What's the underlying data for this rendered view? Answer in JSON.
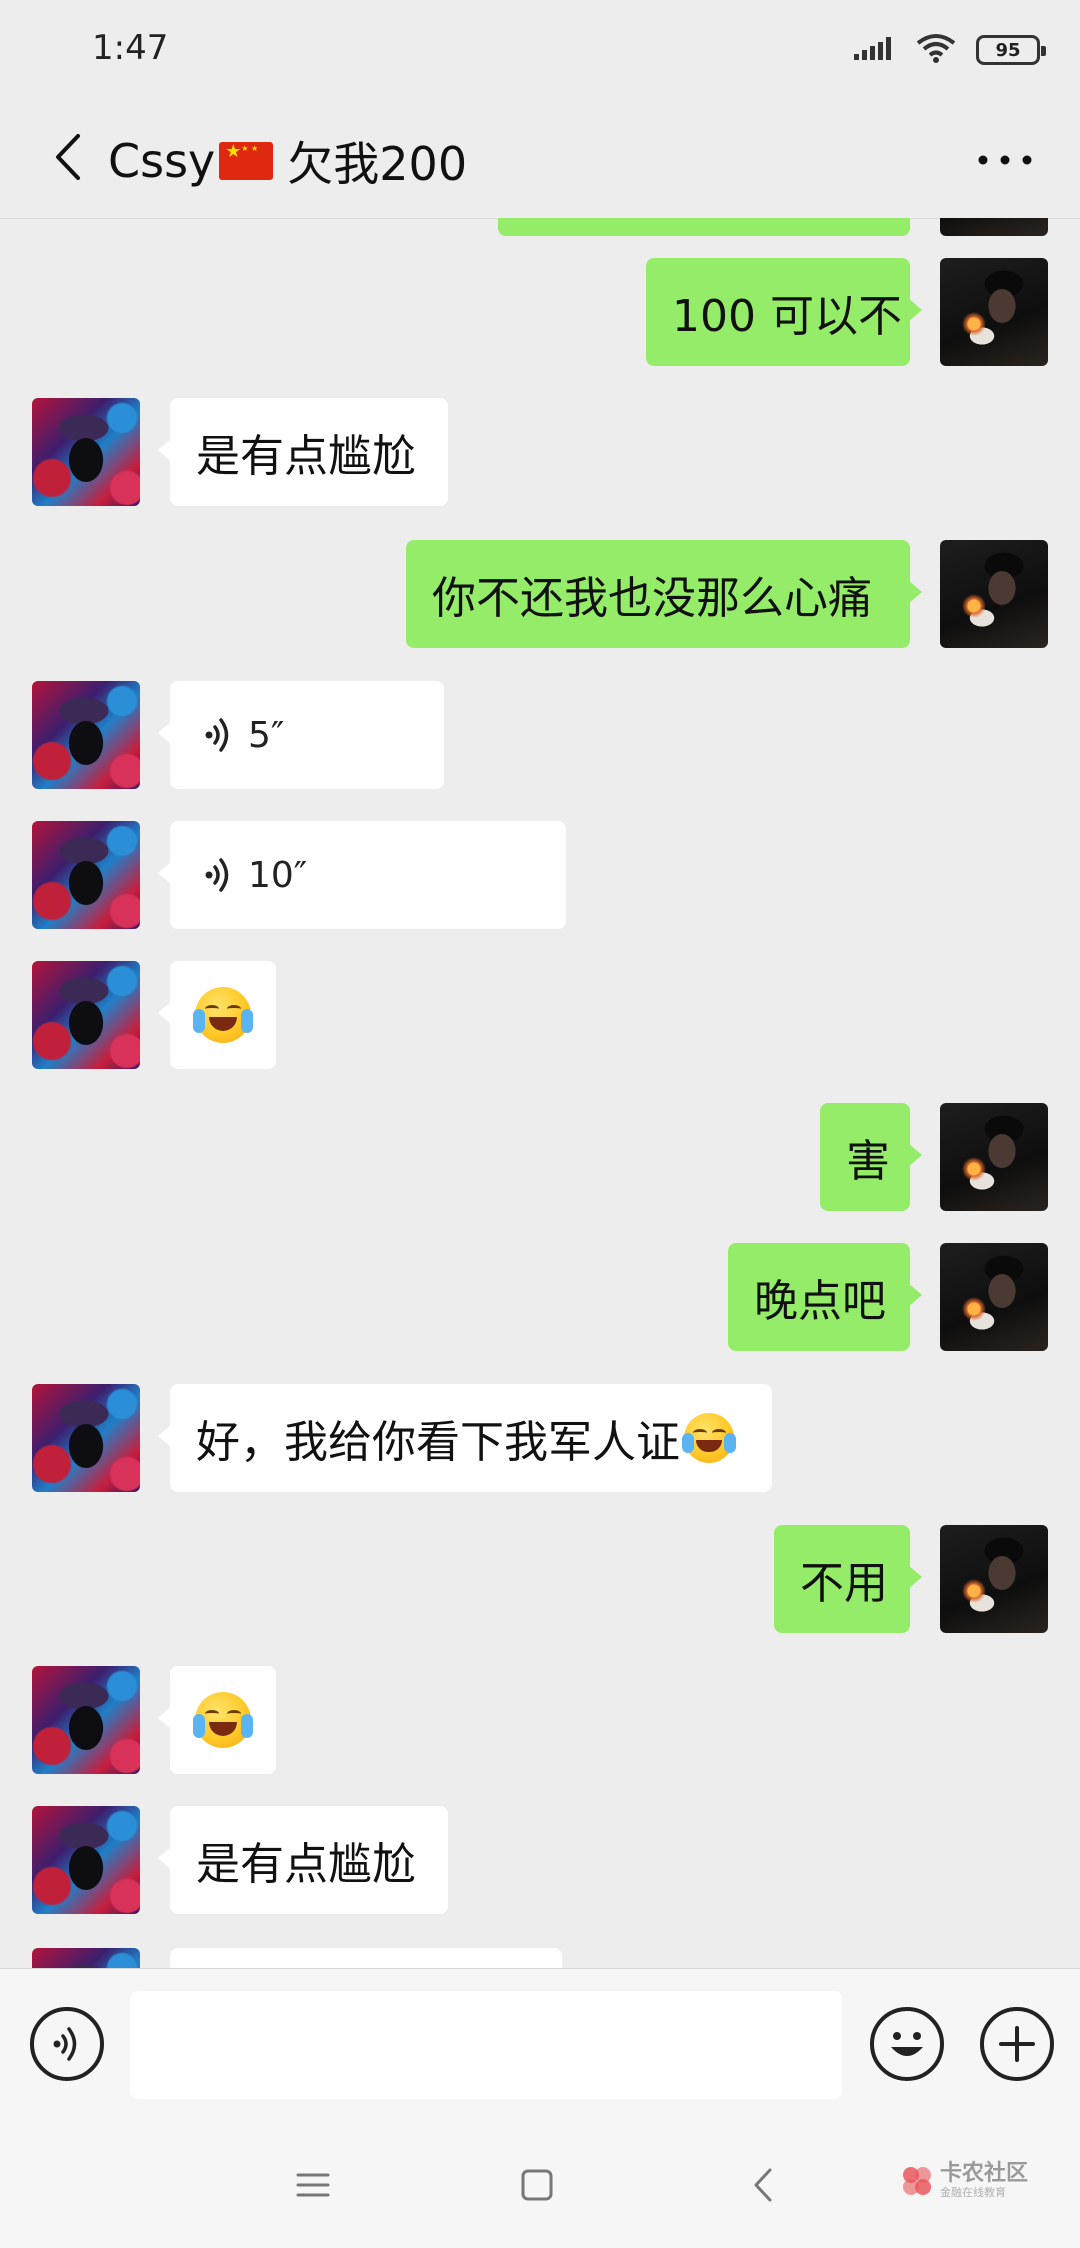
{
  "status_bar": {
    "time": "1:47",
    "battery": "95"
  },
  "header": {
    "title": "Cssy",
    "title_suffix": "欠我200"
  },
  "messages": [
    {
      "from": "me",
      "type": "text",
      "text": "100 可以不"
    },
    {
      "from": "them",
      "type": "text",
      "text": "是有点尴尬"
    },
    {
      "from": "me",
      "type": "text",
      "text": "你不还我也没那么心痛"
    },
    {
      "from": "them",
      "type": "voice",
      "duration": "5″"
    },
    {
      "from": "them",
      "type": "voice",
      "duration": "10″"
    },
    {
      "from": "them",
      "type": "emoji",
      "emoji": "facepalm-laugh-emoji"
    },
    {
      "from": "me",
      "type": "text",
      "text": "害"
    },
    {
      "from": "me",
      "type": "text",
      "text": "晚点吧"
    },
    {
      "from": "them",
      "type": "text",
      "text": "好，我给你看下我军人证"
    },
    {
      "from": "me",
      "type": "text",
      "text": "不用"
    },
    {
      "from": "them",
      "type": "emoji",
      "emoji": "facepalm-laugh-emoji"
    },
    {
      "from": "them",
      "type": "text",
      "text": "是有点尴尬"
    }
  ],
  "watermark": {
    "main": "卡农社区",
    "sub": "金融在线教育"
  },
  "colors": {
    "background": "#ededed",
    "my_bubble": "#95ec69",
    "their_bubble": "#ffffff"
  }
}
